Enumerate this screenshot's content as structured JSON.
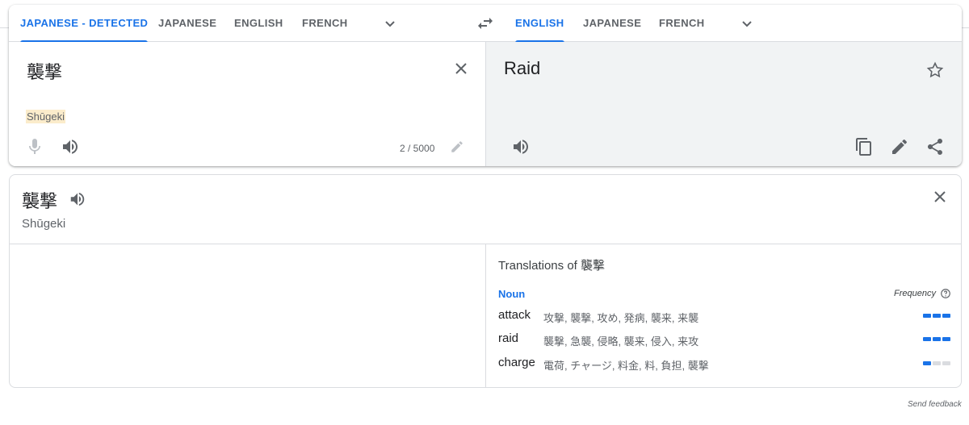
{
  "source_langs": {
    "tabs": [
      "JAPANESE - DETECTED",
      "JAPANESE",
      "ENGLISH",
      "FRENCH"
    ],
    "active": 0
  },
  "target_langs": {
    "tabs": [
      "ENGLISH",
      "JAPANESE",
      "FRENCH"
    ],
    "active": 0
  },
  "source": {
    "text": "襲撃",
    "transliteration": "Shūgeki",
    "counter": "2 / 5000"
  },
  "target": {
    "text": "Raid"
  },
  "dictionary": {
    "word": "襲撃",
    "transliteration": "Shūgeki",
    "translations_title": "Translations of 襲撃",
    "part_of_speech": "Noun",
    "frequency_label": "Frequency",
    "rows": [
      {
        "term": "attack",
        "synonyms": "攻撃, 襲撃, 攻め, 発病, 襲来, 来襲",
        "frequency": 3
      },
      {
        "term": "raid",
        "synonyms": "襲撃, 急襲, 侵略, 襲来, 侵入, 来攻",
        "frequency": 3
      },
      {
        "term": "charge",
        "synonyms": "電荷, チャージ, 料金, 料, 負担, 襲撃",
        "frequency": 1
      }
    ]
  },
  "feedback_label": "Send feedback",
  "colors": {
    "accent": "#1a73e8",
    "target_bg": "#f1f3f4",
    "highlight": "#fbeccb"
  }
}
